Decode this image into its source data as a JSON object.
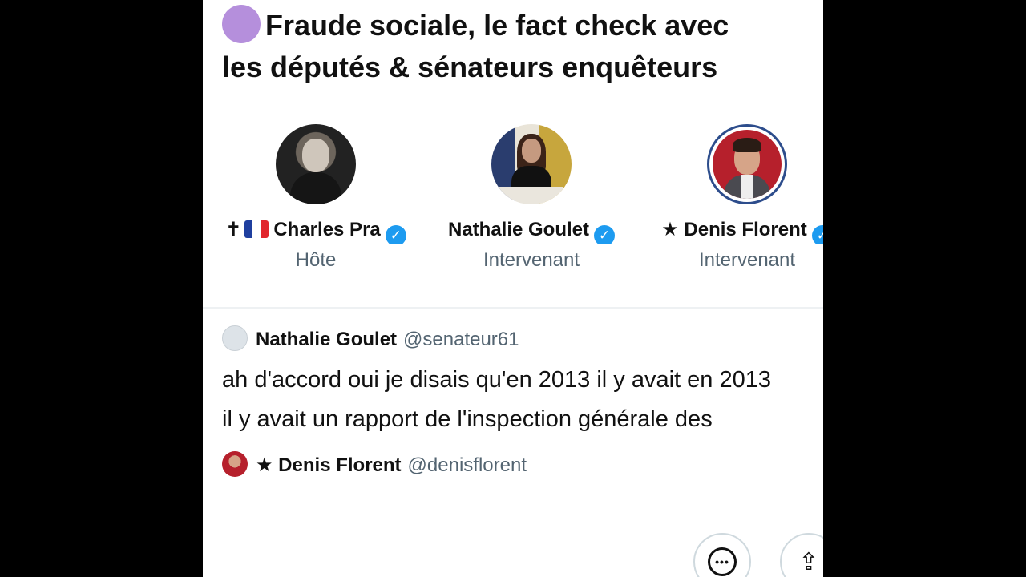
{
  "space": {
    "title_emoji": "purple-circle",
    "title_lines": [
      "Fraude sociale, le fact check avec",
      "les députés & sénateurs enquêteurs"
    ]
  },
  "speakers": [
    {
      "prefix": "✝",
      "flag": "france-flag",
      "name": "Charles Pra",
      "verified": true,
      "role": "Hôte"
    },
    {
      "prefix": "",
      "name": "Nathalie Goulet",
      "verified": true,
      "role": "Intervenant"
    },
    {
      "prefix": "★",
      "name": "Denis Florent",
      "verified": true,
      "role": "Intervenant"
    }
  ],
  "captions": [
    {
      "name": "Nathalie Goulet",
      "handle": "@senateur61",
      "lines": [
        "ah d'accord oui je disais qu'en 2013 il y avait en 2013",
        "il y avait un rapport de l'inspection générale des"
      ]
    },
    {
      "name": "★ Denis Florent",
      "handle": "@denisflorent"
    }
  ],
  "actions": {
    "more_icon": "more-icon",
    "share_icon": "share-icon",
    "verified_mark": "✓",
    "more_glyph": "•••",
    "share_glyph": "⇪"
  },
  "colors": {
    "accent": "#1d9bf0",
    "title_dot": "#b58fdc",
    "muted": "#536471"
  }
}
